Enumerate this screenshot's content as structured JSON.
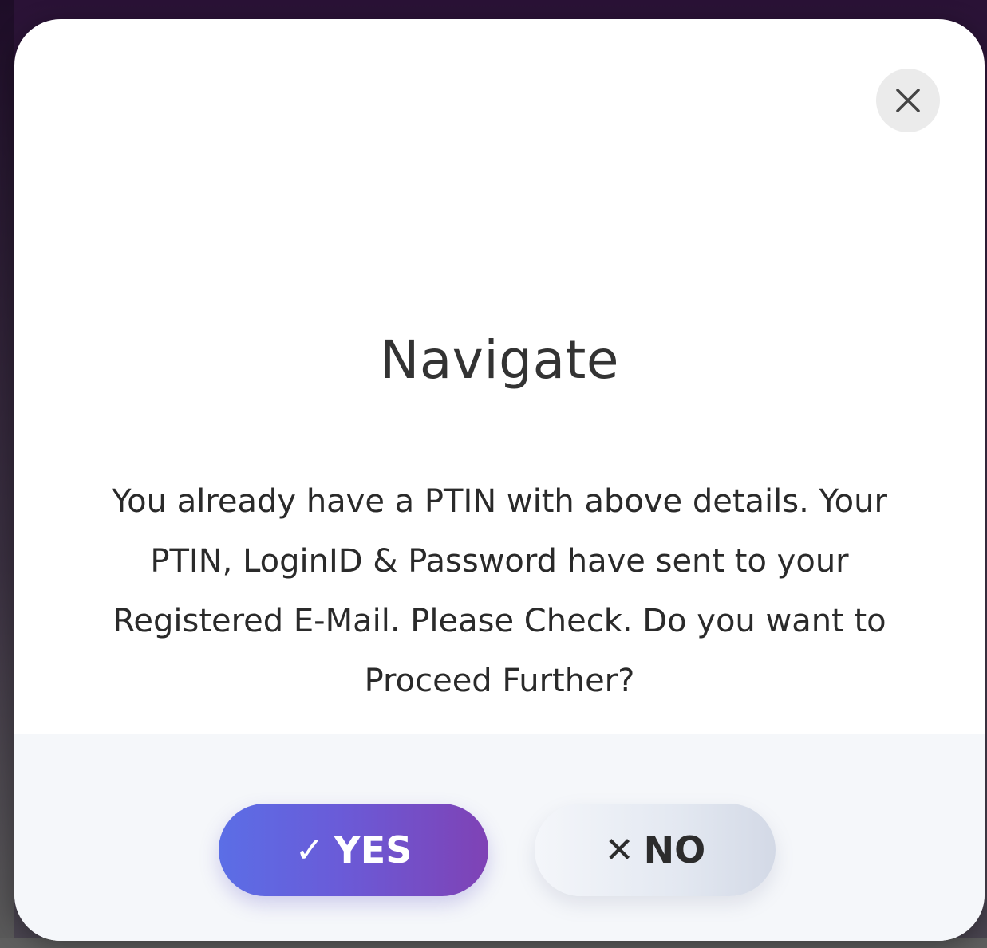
{
  "dialog": {
    "title": "Navigate",
    "message": "You already have a PTIN with above details. Your PTIN, LoginID & Password have sent to your Registered E-Mail. Please Check. Do you want to Proceed Further?",
    "close_icon": "close-icon"
  },
  "buttons": {
    "yes": {
      "icon": "check-icon",
      "glyph": "✓",
      "label": "YES"
    },
    "no": {
      "icon": "close-icon",
      "glyph": "✕",
      "label": "NO"
    }
  },
  "colors": {
    "yes_gradient_start": "#5b6ee6",
    "yes_gradient_end": "#7f42b5",
    "no_background": "#e3e8f1",
    "footer_background": "#f5f7fa",
    "title_text": "#333333"
  }
}
